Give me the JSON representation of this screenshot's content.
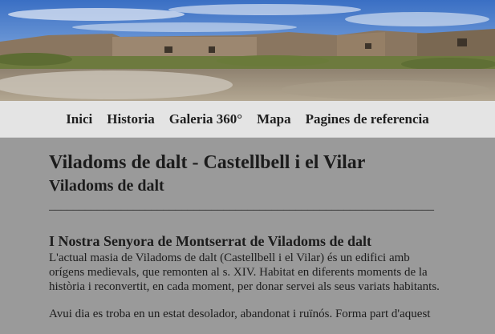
{
  "colors": {
    "page_background": "#9a9a9a",
    "navbar_background": "#e4e4e4",
    "text": "#1c1c1c"
  },
  "hero": {
    "image_icon": "castle-ruins-landscape-photo"
  },
  "nav": {
    "items": [
      {
        "label": "Inici"
      },
      {
        "label": "Historia"
      },
      {
        "label": "Galeria 360°"
      },
      {
        "label": "Mapa"
      },
      {
        "label": "Pagines de referencia"
      }
    ]
  },
  "main": {
    "title": "Viladoms de dalt - Castellbell i el Vilar",
    "subtitle": "Viladoms de dalt",
    "separator": "________________________________________________________________",
    "section_heading": "I Nostra Senyora de Montserrat de Viladoms de dalt",
    "paragraph_1": "L'actual masia de Viladoms de dalt (Castellbell i el Vilar) és un edifici amb orígens medievals, que remonten al s. XIV. Habitat en diferents moments de la història i reconvertit, en cada moment, per donar servei als seus variats habitants.",
    "paragraph_2": "Avui dia es troba en un estat desolador, abandonat i ruïnós. Forma part d'aquest"
  }
}
